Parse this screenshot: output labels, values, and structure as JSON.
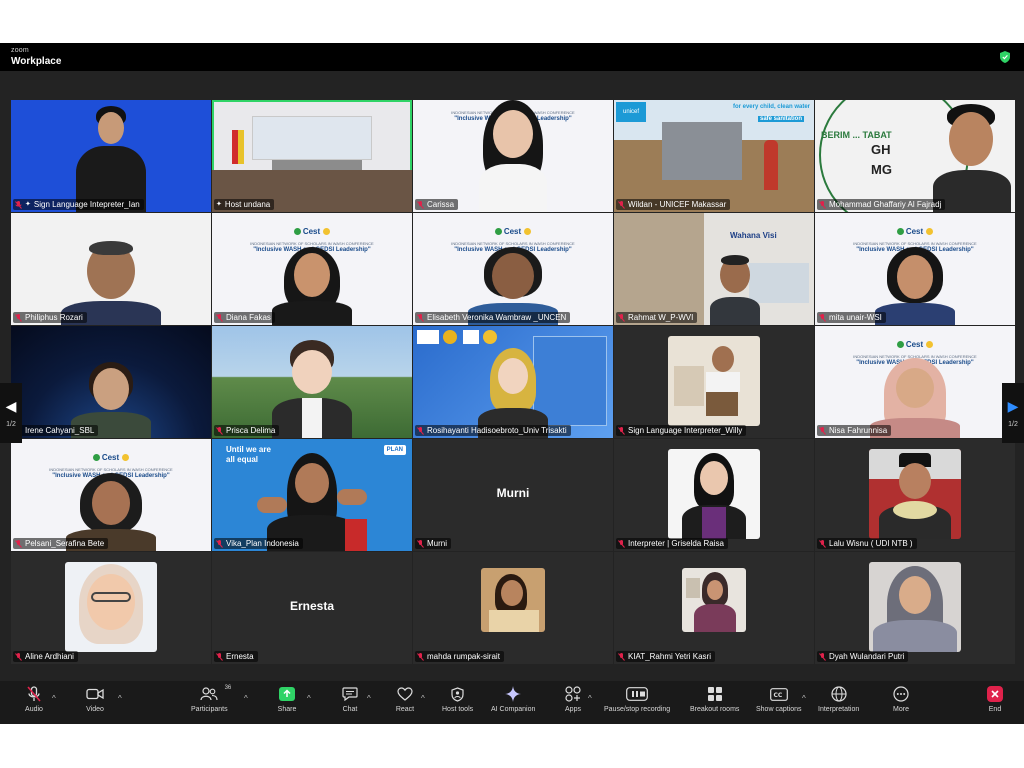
{
  "app": {
    "brand_small": "zoom",
    "brand_big": "Workplace"
  },
  "pagination": {
    "left": "1/2",
    "right": "1/2"
  },
  "participants": [
    {
      "name": "Sign Language Intepreter_Ian",
      "pinned": true
    },
    {
      "name": "Host undana",
      "pinned": true
    },
    {
      "name": "Carissa"
    },
    {
      "name": "Wildan - UNICEF Makassar"
    },
    {
      "name": "Mohammad Ghaffariy Al Fajradj"
    },
    {
      "name": "Philiphus Rozari"
    },
    {
      "name": "Diana Fakas"
    },
    {
      "name": "Elisabeth Veronika Wambraw _UNCEN"
    },
    {
      "name": "Rahmat W_P-WVI"
    },
    {
      "name": "mita unair-WSI"
    },
    {
      "name": "Irene Cahyani_SBL"
    },
    {
      "name": "Prisca Delima"
    },
    {
      "name": "Rosihayanti Hadisoebroto_Univ Trisakti"
    },
    {
      "name": "Sign Language Interpreter_Willy"
    },
    {
      "name": "Nisa Fahrunnisa"
    },
    {
      "name": "Pelsani_Serafina Bete"
    },
    {
      "name": "Vika_Plan Indonesia"
    },
    {
      "name": "Murni",
      "center_label": "Murni"
    },
    {
      "name": "Interpreter | Griselda Raisa"
    },
    {
      "name": "Lalu Wisnu ( UDI NTB )"
    },
    {
      "name": "Aline Ardhiani"
    },
    {
      "name": "Ernesta",
      "center_label": "Ernesta"
    },
    {
      "name": "mahda rumpak-sirait"
    },
    {
      "name": "KIAT_Rahmi Yetri Kasri"
    },
    {
      "name": "Dyah Wulandari Putri"
    }
  ],
  "tiles_text": {
    "cest_logo": "Cest",
    "cest_line": "INDONESIAN NETWORK OF SCHOLARS IN WASH CONFERENCE",
    "cest_title": "\"Inclusive WASH and GEDSI Leadership\"",
    "unicef_banner_1": "for every child, clean water",
    "unicef_banner_2": "safe sanitation",
    "unicef_logo": "unicef",
    "mural_text_1": "GH",
    "mural_text_2": "MG",
    "seal_text": "BERIM ... TABAT",
    "wahana_logo": "Wahana Visi",
    "plan_slogan_1": "Until we are",
    "plan_slogan_2": "all equal",
    "plan_logo": "PLAN"
  },
  "toolbar": {
    "audio": "Audio",
    "video": "Video",
    "participants": "Participants",
    "participants_count": "36",
    "share": "Share",
    "chat": "Chat",
    "react": "React",
    "host_tools": "Host tools",
    "ai_companion": "AI Companion",
    "apps": "Apps",
    "recording": "Pause/stop recording",
    "breakout": "Breakout rooms",
    "captions": "Show captions",
    "interpretation": "Interpretation",
    "more": "More",
    "end": "End"
  },
  "colors": {
    "active_speaker": "#2fd366",
    "share_green": "#2fd366",
    "end_red": "#e0224b",
    "toolbar_bg": "#1a1a1a"
  }
}
